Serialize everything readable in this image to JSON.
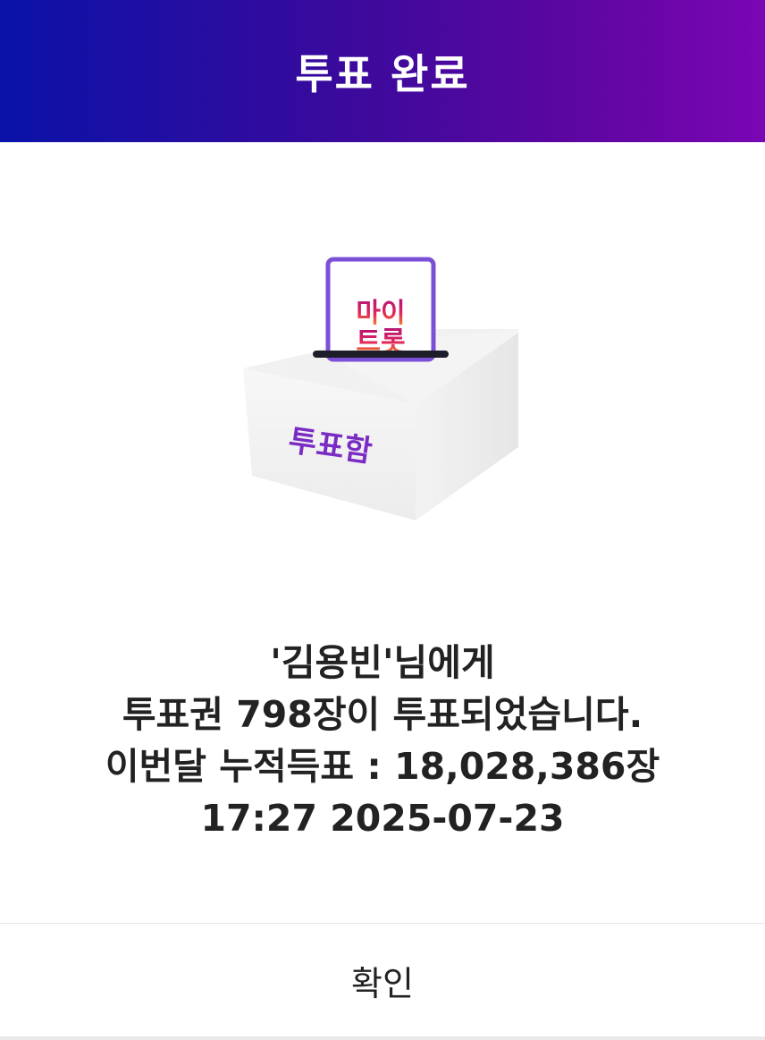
{
  "dialog": {
    "title": "투표 완료",
    "illustration": {
      "ballot_text_line1": "마이",
      "ballot_text_line2": "트롯",
      "box_label": "투표함"
    },
    "message": {
      "line1": "'김용빈'님에게",
      "line2": "투표권 798장이 투표되었습니다.",
      "line3": "이번달 누적득표 : 18,028,386장",
      "line4": "17:27 2025-07-23"
    },
    "confirm_label": "확인"
  },
  "colors": {
    "header_start": "#0a12a8",
    "header_end": "#7a06b4",
    "ballot_border": "#7b4fd6",
    "box_label": "#7a2bc4"
  }
}
